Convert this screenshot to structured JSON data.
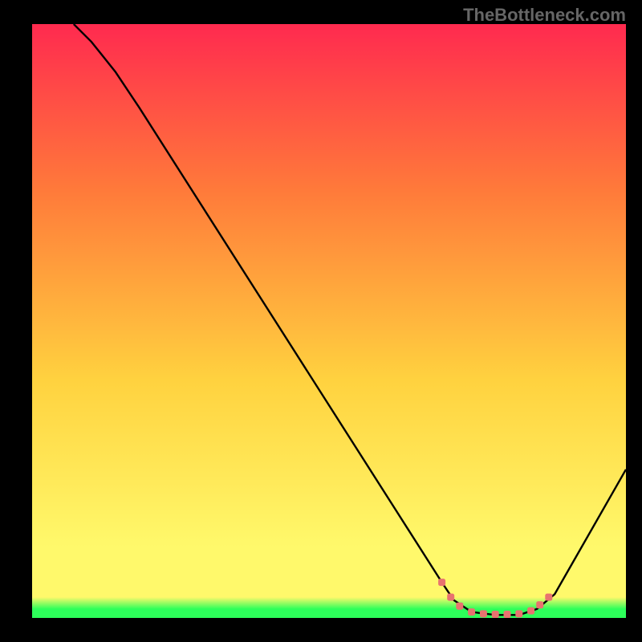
{
  "watermark": "TheBottleneck.com",
  "chart_data": {
    "type": "line",
    "title": "",
    "xlabel": "",
    "ylabel": "",
    "xlim": [
      0,
      100
    ],
    "ylim": [
      0,
      100
    ],
    "gradient_colors": {
      "top": "#ff2a4f",
      "upper_mid": "#ff7a3a",
      "mid": "#ffd23f",
      "lower_mid": "#fff96b",
      "bottom": "#2dff5a"
    },
    "series": [
      {
        "name": "curve",
        "color": "#000000",
        "points": [
          {
            "x": 7,
            "y": 100
          },
          {
            "x": 10,
            "y": 97
          },
          {
            "x": 14,
            "y": 92
          },
          {
            "x": 18,
            "y": 86
          },
          {
            "x": 69,
            "y": 6
          },
          {
            "x": 71,
            "y": 3
          },
          {
            "x": 74,
            "y": 1
          },
          {
            "x": 78,
            "y": 0.5
          },
          {
            "x": 82,
            "y": 0.5
          },
          {
            "x": 85,
            "y": 1.5
          },
          {
            "x": 88,
            "y": 4
          },
          {
            "x": 100,
            "y": 25
          }
        ]
      }
    ],
    "markers": {
      "color": "#e8736f",
      "points": [
        {
          "x": 69,
          "y": 6
        },
        {
          "x": 70.5,
          "y": 3.5
        },
        {
          "x": 72,
          "y": 2
        },
        {
          "x": 74,
          "y": 1
        },
        {
          "x": 76,
          "y": 0.7
        },
        {
          "x": 78,
          "y": 0.6
        },
        {
          "x": 80,
          "y": 0.6
        },
        {
          "x": 82,
          "y": 0.7
        },
        {
          "x": 84,
          "y": 1.2
        },
        {
          "x": 85.5,
          "y": 2.2
        },
        {
          "x": 87,
          "y": 3.5
        }
      ]
    }
  }
}
